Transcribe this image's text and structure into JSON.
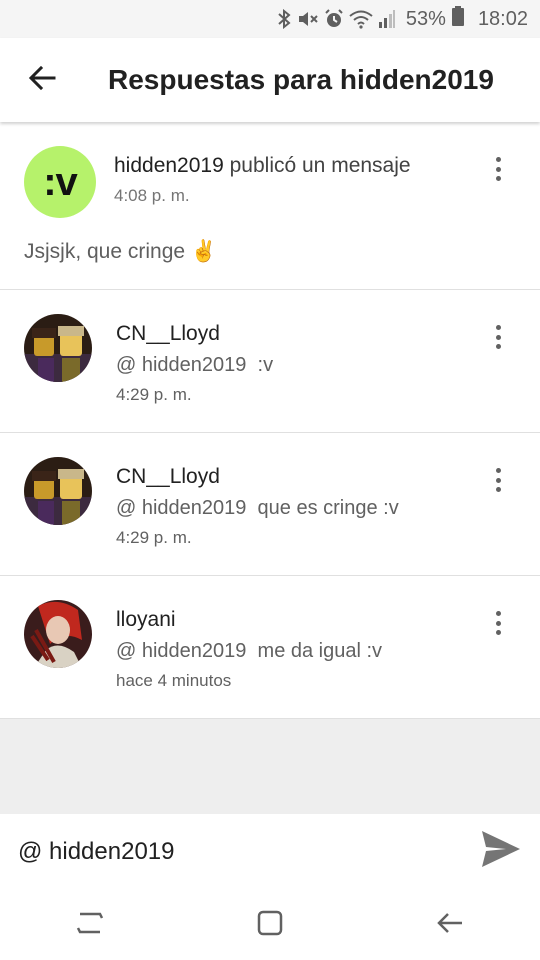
{
  "status_bar": {
    "battery_pct": "53%",
    "time": "18:02",
    "icons": [
      "bluetooth-icon",
      "mute-icon",
      "alarm-icon",
      "wifi-icon",
      "signal-icon",
      "battery-icon"
    ]
  },
  "app_bar": {
    "title": "Respuestas para hidden2019",
    "back_icon": "arrow-back-icon"
  },
  "post": {
    "avatar_text": ":v",
    "avatar_color": "#b6f26b",
    "author": "hidden2019",
    "action": "publicó un mensaje",
    "time": "4:08 p. m.",
    "body": "Jsjsjk, que cringe ✌️"
  },
  "replies": [
    {
      "name": "CN__Lloyd",
      "mention": "@ hidden2019",
      "text": "  :v",
      "time": "4:29 p. m."
    },
    {
      "name": "CN__Lloyd",
      "mention": "@ hidden2019",
      "text": "  que es cringe :v",
      "time": "4:29 p. m."
    },
    {
      "name": "lloyani",
      "mention": "@ hidden2019",
      "text": "  me da igual :v",
      "time": "hace 4 minutos"
    }
  ],
  "composer": {
    "value": "@ hidden2019",
    "send_icon": "send-icon"
  },
  "nav_bar": {
    "icons": [
      "recents-icon",
      "home-icon",
      "back-icon"
    ]
  }
}
